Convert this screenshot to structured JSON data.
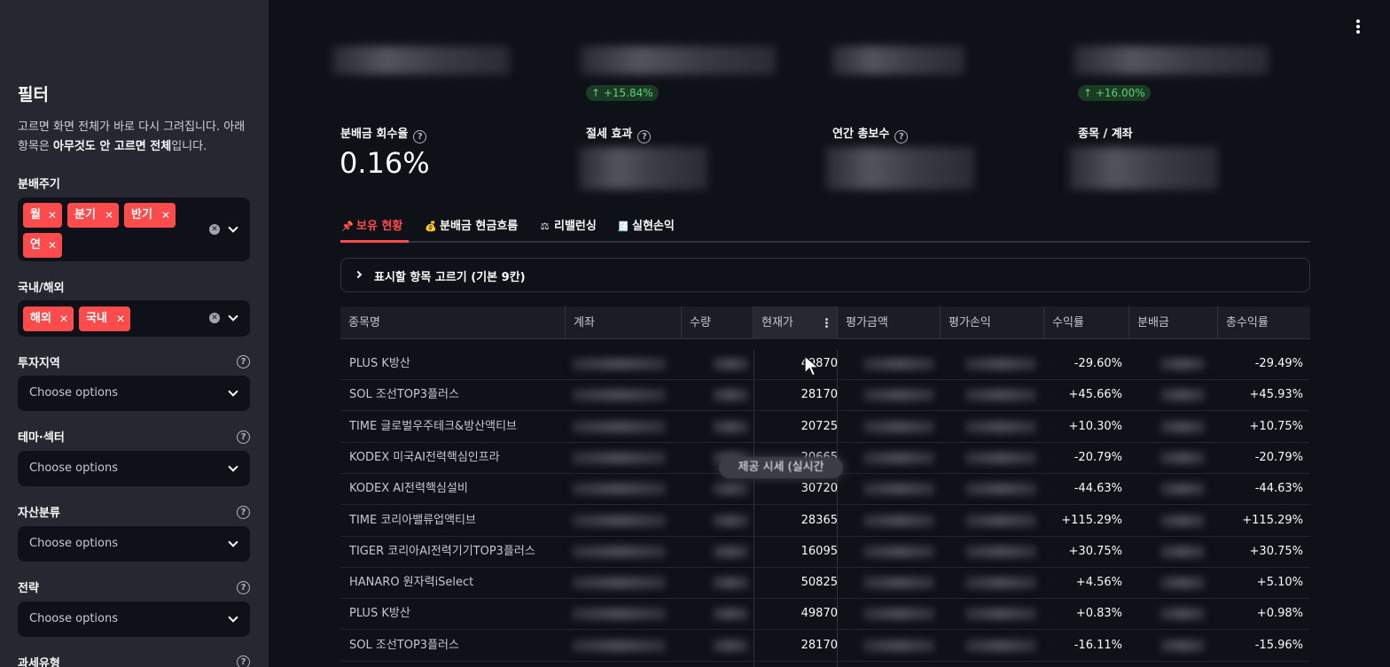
{
  "sidebar": {
    "title": "필터",
    "desc_part1": "고르면 화면 전체가 바로 다시 그려집니다. 아래 항목은 ",
    "desc_bold": "아무것도 안 고르면 전체",
    "desc_part2": "입니다.",
    "filters": {
      "period": {
        "label": "분배주기",
        "chips": [
          "월",
          "분기",
          "반기",
          "연"
        ]
      },
      "region": {
        "label": "국내/해외",
        "chips": [
          "해외",
          "국내"
        ]
      },
      "invest_region": {
        "label": "투자지역",
        "placeholder": "Choose options"
      },
      "theme": {
        "label": "테마·섹터",
        "placeholder": "Choose options"
      },
      "asset": {
        "label": "자산분류",
        "placeholder": "Choose options"
      },
      "strategy": {
        "label": "전략",
        "placeholder": "Choose options"
      },
      "tax": {
        "label": "과세유형"
      }
    }
  },
  "metrics": {
    "delta1": "↑ +15.84%",
    "delta2": "↑ +16.00%",
    "recovery_label": "분배금 회수율",
    "recovery_value": "0.16%",
    "tax_label": "절세 효과",
    "fee_label": "연간 총보수",
    "count_label": "종목 / 계좌"
  },
  "tabs": [
    {
      "icon": "📌",
      "label": "보유 현황"
    },
    {
      "icon": "💰",
      "label": "분배금 현금흐름"
    },
    {
      "icon": "⚖",
      "label": "리밸런싱"
    },
    {
      "icon": "🧾",
      "label": "실현손익"
    }
  ],
  "expander_label": "표시할 항목 고르기 (기본 9칸)",
  "table": {
    "headers": [
      "종목명",
      "계좌",
      "수량",
      "현재가",
      "평가금액",
      "평가손익",
      "수익률",
      "분배금",
      "총수익률"
    ],
    "rows": [
      {
        "name": "PLUS K방산",
        "price": "49870",
        "yield": "-29.60%",
        "total": "-29.49%"
      },
      {
        "name": "SOL 조선TOP3플러스",
        "price": "28170",
        "yield": "+45.66%",
        "total": "+45.93%"
      },
      {
        "name": "TIME 글로벌우주테크&방산액티브",
        "price": "20725",
        "yield": "+10.30%",
        "total": "+10.75%"
      },
      {
        "name": "KODEX 미국AI전력핵심인프라",
        "price": "20665",
        "yield": "-20.79%",
        "total": "-20.79%"
      },
      {
        "name": "KODEX AI전력핵심설비",
        "price": "30720",
        "yield": "-44.63%",
        "total": "-44.63%"
      },
      {
        "name": "TIME 코리아밸류업액티브",
        "price": "28365",
        "yield": "+115.29%",
        "total": "+115.29%"
      },
      {
        "name": "TIGER 코리아AI전력기기TOP3플러스",
        "price": "16095",
        "yield": "+30.75%",
        "total": "+30.75%"
      },
      {
        "name": "HANARO 원자력iSelect",
        "price": "50825",
        "yield": "+4.56%",
        "total": "+5.10%"
      },
      {
        "name": "PLUS K방산",
        "price": "49870",
        "yield": "+0.83%",
        "total": "+0.98%"
      },
      {
        "name": "SOL 조선TOP3플러스",
        "price": "28170",
        "yield": "-16.11%",
        "total": "-15.96%"
      }
    ]
  },
  "tooltip_text": "제공 시세 (실시간"
}
